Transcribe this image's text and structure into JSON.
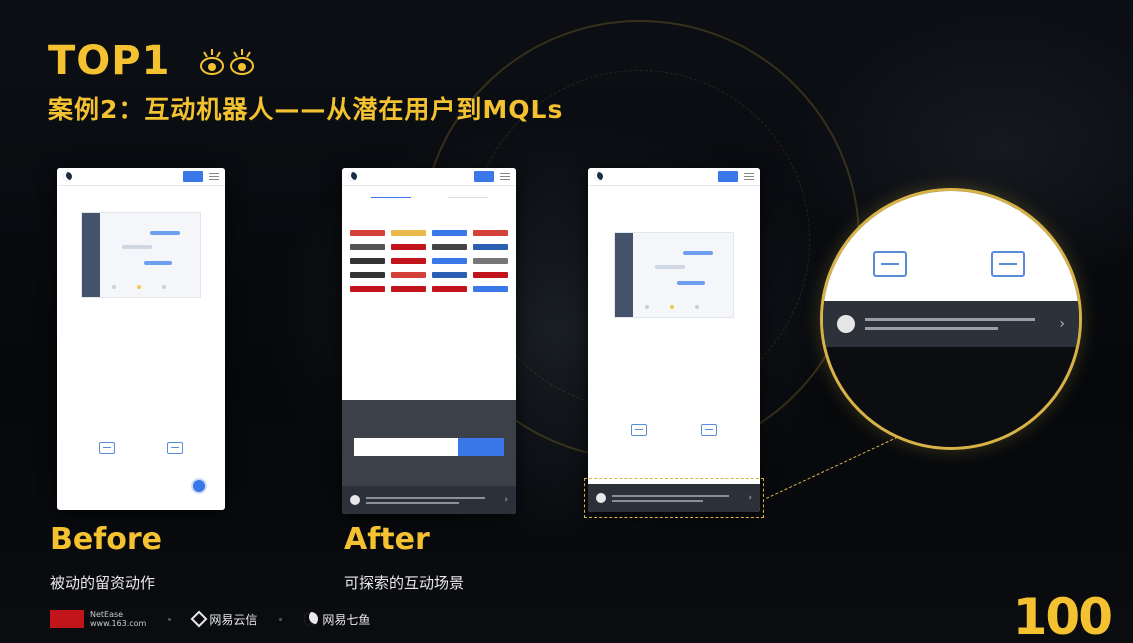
{
  "header": {
    "top_label": "TOP1",
    "title": "案例2：互动机器人——从潜在用户到MQLs"
  },
  "before": {
    "label": "Before",
    "caption": "被动的留资动作"
  },
  "after": {
    "label": "After",
    "caption": "可探索的互动场景"
  },
  "footer": {
    "logo_netease": "NetEase",
    "logo_netease_sub": "www.163.com",
    "logo_yunxin": "网易云信",
    "logo_qiyu": "网易七鱼",
    "page_number": "100"
  },
  "colors": {
    "accent": "#f4c230",
    "phone_button": "#3a77e8",
    "magnifier_ring": "#d7b347"
  }
}
